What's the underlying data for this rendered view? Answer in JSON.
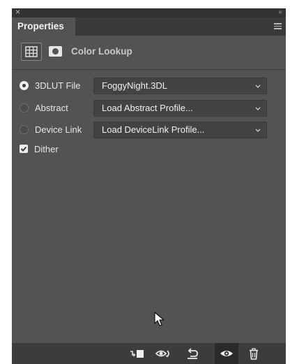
{
  "window": {
    "close_glyph": "×",
    "collapse_glyph": "‹‹",
    "tab_label": "Properties",
    "menu_icon": "panel-menu-icon"
  },
  "header": {
    "adjustment_icon": "grid-icon",
    "mask_icon": "layer-mask-icon",
    "title": "Color Lookup"
  },
  "options": [
    {
      "label": "3DLUT File",
      "selected": true,
      "value": "FoggyNight.3DL"
    },
    {
      "label": "Abstract",
      "selected": false,
      "value": "Load Abstract Profile..."
    },
    {
      "label": "Device Link",
      "selected": false,
      "value": "Load DeviceLink Profile..."
    }
  ],
  "dither": {
    "label": "Dither",
    "checked": true
  },
  "bottom_bar": {
    "icons": [
      "clip-to-layer-icon",
      "view-previous-state-icon",
      "reset-icon",
      "visibility-icon",
      "trash-icon"
    ],
    "active": "visibility-icon"
  },
  "colors": {
    "panel_bg": "#535353",
    "tab_bar_bg": "#3a3a3a",
    "select_bg": "#434343",
    "text": "#e6e6e6"
  }
}
